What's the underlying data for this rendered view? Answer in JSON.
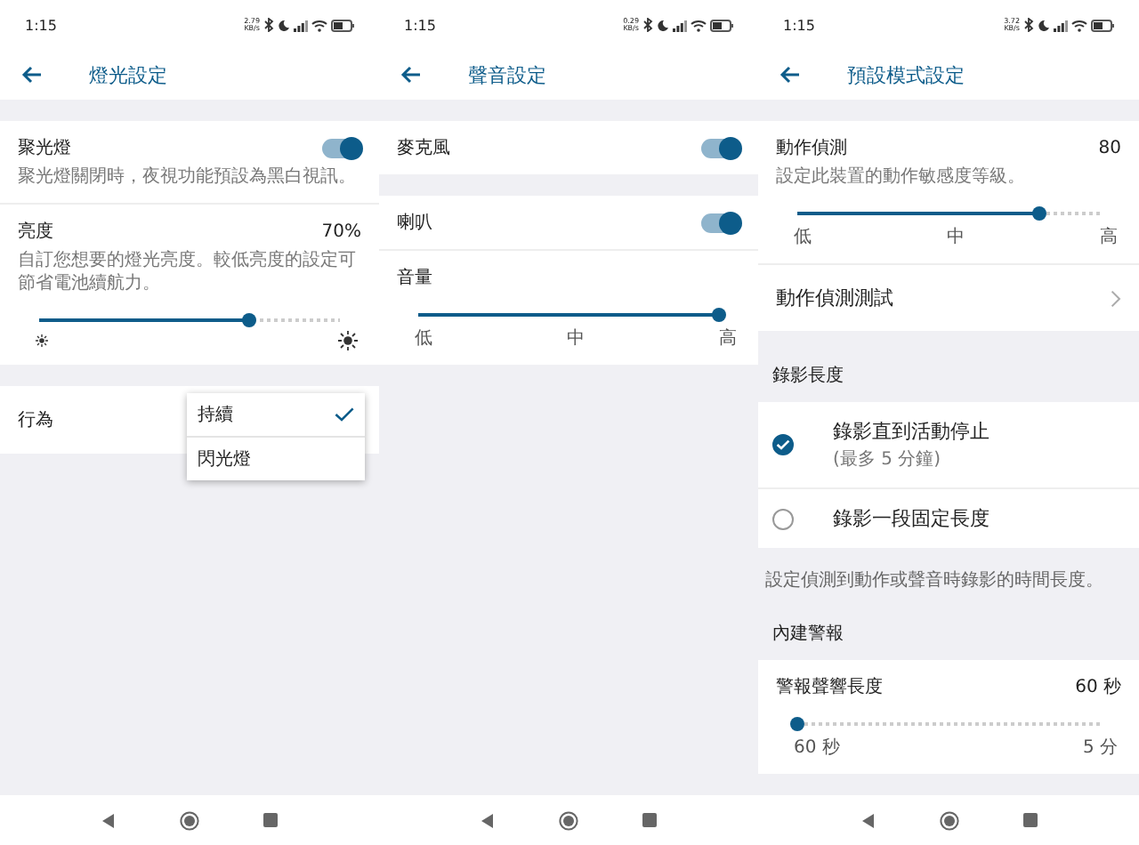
{
  "panels": [
    {
      "status": {
        "time": "1:15",
        "speed": "2.79",
        "unit": "KB/s"
      },
      "title": "燈光設定",
      "blocks": [
        {
          "kind": "card",
          "items": [
            {
              "kind": "toggle",
              "title": "聚光燈",
              "sub": "聚光燈關閉時，夜視功能預設為黑白視訊。",
              "on": true
            },
            {
              "kind": "slider",
              "title": "亮度",
              "value": "70%",
              "desc": "自訂您想要的燈光亮度。較低亮度的設定可節省電池續航力。",
              "level": 0.7
            }
          ]
        },
        {
          "kind": "card",
          "items": [
            {
              "kind": "select",
              "title": "行為",
              "options": [
                {
                  "label": "持續",
                  "selected": true
                },
                {
                  "label": "閃光燈",
                  "selected": false
                }
              ]
            }
          ]
        }
      ]
    },
    {
      "status": {
        "time": "1:15",
        "speed": "0.29",
        "unit": "KB/s"
      },
      "title": "聲音設定",
      "blocks": [
        {
          "kind": "card",
          "items": [
            {
              "kind": "toggle",
              "title": "麥克風",
              "on": true
            }
          ]
        },
        {
          "kind": "card",
          "items": [
            {
              "kind": "toggle",
              "title": "喇叭",
              "on": true
            },
            {
              "kind": "slider",
              "title": "音量",
              "level": 1,
              "labels": [
                "低",
                "中",
                "高"
              ]
            }
          ]
        }
      ]
    },
    {
      "status": {
        "time": "1:15",
        "speed": "3.72",
        "unit": "KB/s"
      },
      "title": "預設模式設定",
      "blocks": [
        {
          "kind": "card",
          "items": [
            {
              "kind": "slider",
              "title": "動作偵測",
              "value": "80",
              "desc": "設定此裝置的動作敏感度等級。",
              "level": 0.8,
              "labels": [
                "低",
                "中",
                "高"
              ]
            },
            {
              "kind": "link",
              "title": "動作偵測測試"
            }
          ]
        },
        {
          "kind": "header",
          "text": "錄影長度"
        },
        {
          "kind": "card",
          "items": [
            {
              "kind": "radio",
              "title": "錄影直到活動停止",
              "sub": "(最多 5 分鐘)",
              "selected": true
            },
            {
              "kind": "radio",
              "title": "錄影一段固定長度",
              "selected": false
            }
          ]
        },
        {
          "kind": "note",
          "text": "設定偵測到動作或聲音時錄影的時間長度。"
        },
        {
          "kind": "header",
          "text": "內建警報"
        },
        {
          "kind": "card",
          "items": [
            {
              "kind": "slider",
              "title": "警報聲響長度",
              "value": "60 秒",
              "level": 0,
              "labels": [
                "60 秒",
                "5 分"
              ]
            }
          ]
        }
      ]
    }
  ]
}
